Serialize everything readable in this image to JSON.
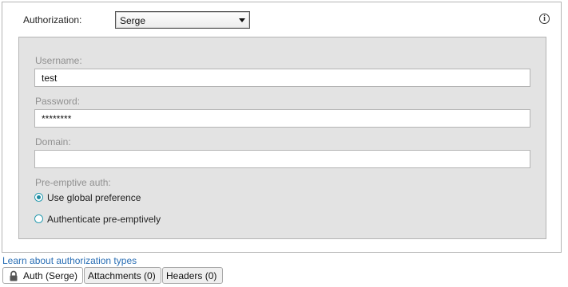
{
  "authorization": {
    "label": "Authorization:",
    "selected": "Serge",
    "info_icon": "info-icon"
  },
  "credentials": {
    "username_label": "Username:",
    "username_value": "test",
    "password_label": "Password:",
    "password_value": "********",
    "domain_label": "Domain:",
    "domain_value": "",
    "preemptive_label": "Pre-emptive auth:",
    "options": [
      {
        "label": "Use global preference",
        "checked": true
      },
      {
        "label": "Authenticate pre-emptively",
        "checked": false
      }
    ]
  },
  "learn_link": "Learn about authorization types",
  "tabs": [
    {
      "label": "Auth (Serge)",
      "icon": "lock-icon",
      "active": true
    },
    {
      "label": "Attachments (0)",
      "active": false
    },
    {
      "label": "Headers (0)",
      "active": false
    }
  ],
  "colors": {
    "accent": "#1e8aa0",
    "link": "#2a6fb5",
    "panel_bg": "#e3e3e3"
  }
}
